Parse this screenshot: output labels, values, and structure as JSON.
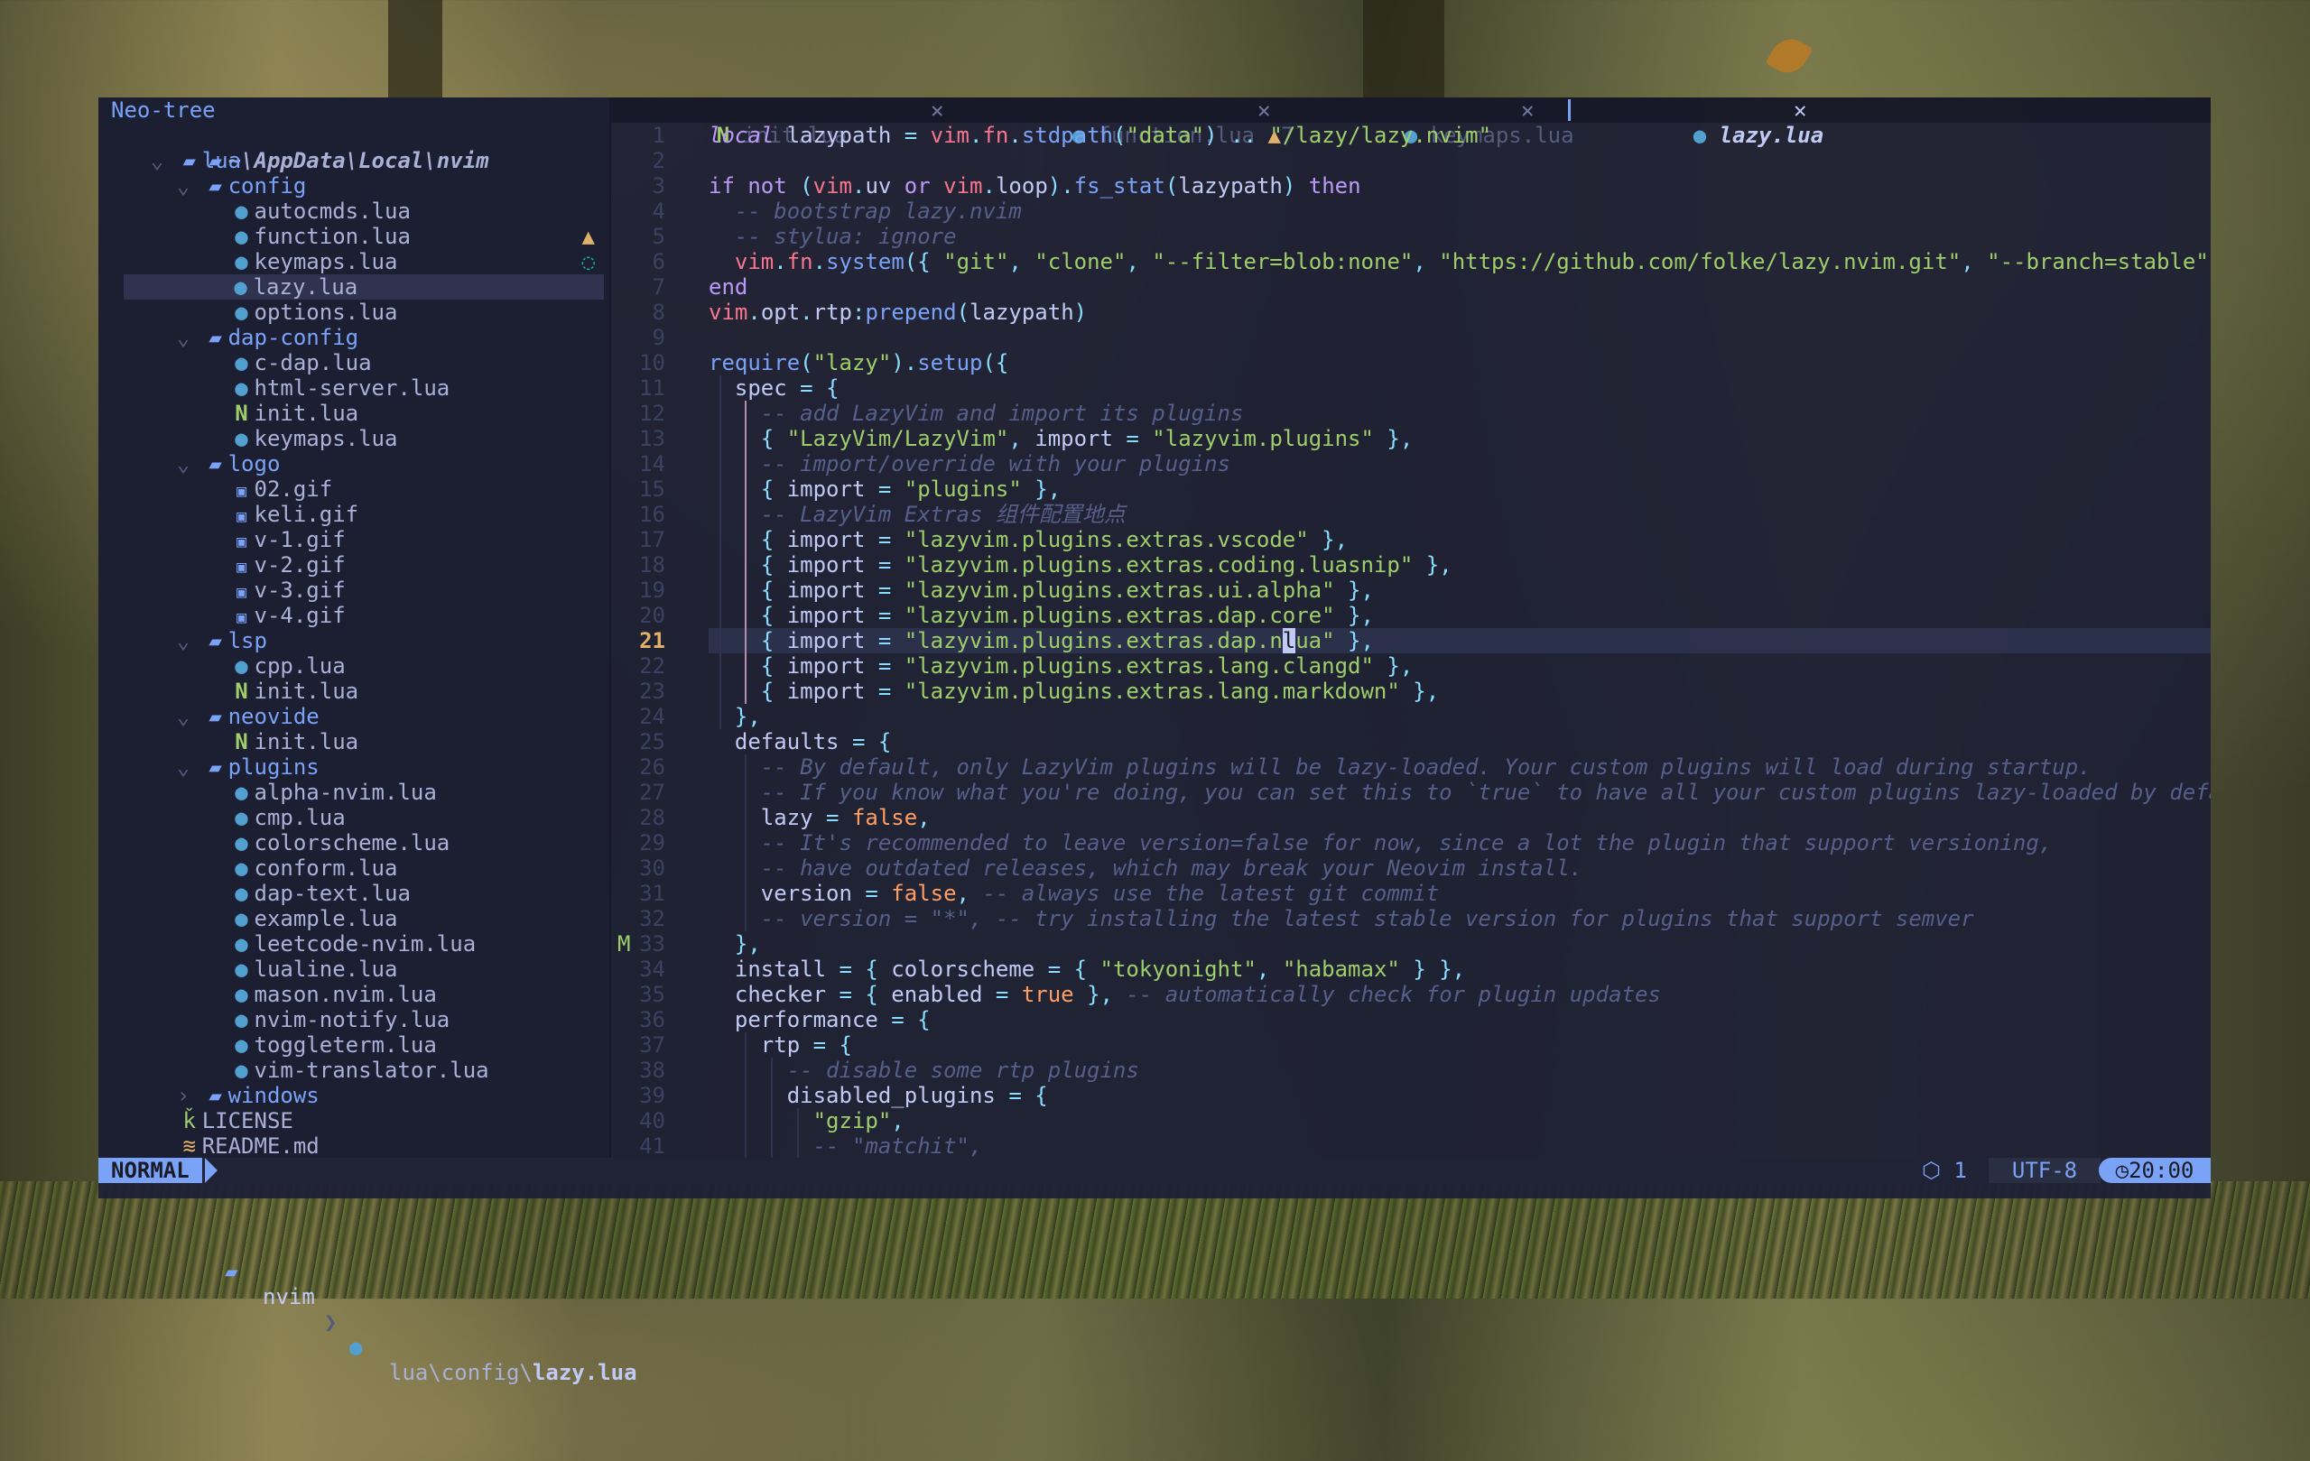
{
  "sidebar": {
    "title": "Neo-tree",
    "root": "~\\AppData\\Local\\nvim",
    "rows": [
      {
        "depth": 1,
        "type": "folder",
        "open": true,
        "name": "lua"
      },
      {
        "depth": 2,
        "type": "folder",
        "open": true,
        "name": "config"
      },
      {
        "depth": 3,
        "type": "lua",
        "name": "autocmds.lua"
      },
      {
        "depth": 3,
        "type": "lua",
        "name": "function.lua",
        "marker": "warn"
      },
      {
        "depth": 3,
        "type": "lua",
        "name": "keymaps.lua",
        "marker": "hint"
      },
      {
        "depth": 3,
        "type": "lua",
        "name": "lazy.lua",
        "selected": true
      },
      {
        "depth": 3,
        "type": "lua",
        "name": "options.lua"
      },
      {
        "depth": 2,
        "type": "folder",
        "open": true,
        "name": "dap-config"
      },
      {
        "depth": 3,
        "type": "lua",
        "name": "c-dap.lua"
      },
      {
        "depth": 3,
        "type": "lua",
        "name": "html-server.lua"
      },
      {
        "depth": 3,
        "type": "neovim",
        "name": "init.lua"
      },
      {
        "depth": 3,
        "type": "lua",
        "name": "keymaps.lua"
      },
      {
        "depth": 2,
        "type": "folder",
        "open": true,
        "name": "logo"
      },
      {
        "depth": 3,
        "type": "gif",
        "name": "02.gif"
      },
      {
        "depth": 3,
        "type": "gif",
        "name": "keli.gif"
      },
      {
        "depth": 3,
        "type": "gif",
        "name": "v-1.gif"
      },
      {
        "depth": 3,
        "type": "gif",
        "name": "v-2.gif"
      },
      {
        "depth": 3,
        "type": "gif",
        "name": "v-3.gif"
      },
      {
        "depth": 3,
        "type": "gif",
        "name": "v-4.gif"
      },
      {
        "depth": 2,
        "type": "folder",
        "open": true,
        "name": "lsp"
      },
      {
        "depth": 3,
        "type": "lua",
        "name": "cpp.lua"
      },
      {
        "depth": 3,
        "type": "neovim",
        "name": "init.lua"
      },
      {
        "depth": 2,
        "type": "folder",
        "open": true,
        "name": "neovide"
      },
      {
        "depth": 3,
        "type": "neovim",
        "name": "init.lua"
      },
      {
        "depth": 2,
        "type": "folder",
        "open": true,
        "name": "plugins"
      },
      {
        "depth": 3,
        "type": "lua",
        "name": "alpha-nvim.lua"
      },
      {
        "depth": 3,
        "type": "lua",
        "name": "cmp.lua"
      },
      {
        "depth": 3,
        "type": "lua",
        "name": "colorscheme.lua"
      },
      {
        "depth": 3,
        "type": "lua",
        "name": "conform.lua"
      },
      {
        "depth": 3,
        "type": "lua",
        "name": "dap-text.lua"
      },
      {
        "depth": 3,
        "type": "lua",
        "name": "example.lua"
      },
      {
        "depth": 3,
        "type": "lua",
        "name": "leetcode-nvim.lua",
        "marker": "modified",
        "marker_text": "M"
      },
      {
        "depth": 3,
        "type": "lua",
        "name": "lualine.lua"
      },
      {
        "depth": 3,
        "type": "lua",
        "name": "mason.nvim.lua"
      },
      {
        "depth": 3,
        "type": "lua",
        "name": "nvim-notify.lua"
      },
      {
        "depth": 3,
        "type": "lua",
        "name": "toggleterm.lua"
      },
      {
        "depth": 3,
        "type": "lua",
        "name": "vim-translator.lua"
      },
      {
        "depth": 2,
        "type": "folder",
        "open": false,
        "name": "windows"
      },
      {
        "depth": 1,
        "type": "license",
        "name": "LICENSE"
      },
      {
        "depth": 1,
        "type": "readme",
        "name": "README.md"
      }
    ]
  },
  "tabs": [
    {
      "icon": "neovim",
      "label": "init.lua",
      "active": false
    },
    {
      "icon": "lua",
      "label": "function.lua",
      "active": false,
      "diag": "7"
    },
    {
      "icon": "lua",
      "label": "keymaps.lua",
      "active": false
    },
    {
      "icon": "lua",
      "label": "lazy.lua",
      "active": true
    }
  ],
  "editor": {
    "current_line": 21,
    "lines": [
      [
        [
          "k",
          "local"
        ],
        [
          "v",
          " lazypath "
        ],
        [
          "p",
          "="
        ],
        [
          "v",
          " "
        ],
        [
          "id",
          "vim"
        ],
        [
          "p",
          "."
        ],
        [
          "id",
          "fn"
        ],
        [
          "p",
          "."
        ],
        [
          "f",
          "stdpath"
        ],
        [
          "p",
          "("
        ],
        [
          "s",
          "\"data\""
        ],
        [
          "p",
          ")"
        ],
        [
          "v",
          " "
        ],
        [
          "p",
          ".."
        ],
        [
          "v",
          " "
        ],
        [
          "s",
          "\"/lazy/lazy.nvim\""
        ]
      ],
      [],
      [
        [
          "kw",
          "if"
        ],
        [
          "v",
          " "
        ],
        [
          "kw",
          "not"
        ],
        [
          "v",
          " "
        ],
        [
          "p",
          "("
        ],
        [
          "id",
          "vim"
        ],
        [
          "p",
          "."
        ],
        [
          "v",
          "uv "
        ],
        [
          "kw",
          "or"
        ],
        [
          "v",
          " "
        ],
        [
          "id",
          "vim"
        ],
        [
          "p",
          "."
        ],
        [
          "v",
          "loop"
        ],
        [
          "p",
          ")."
        ],
        [
          "f",
          "fs_stat"
        ],
        [
          "p",
          "("
        ],
        [
          "v",
          "lazypath"
        ],
        [
          "p",
          ")"
        ],
        [
          "v",
          " "
        ],
        [
          "kw",
          "then"
        ]
      ],
      [
        [
          "v",
          "  "
        ],
        [
          "c",
          "-- bootstrap lazy.nvim"
        ]
      ],
      [
        [
          "v",
          "  "
        ],
        [
          "c",
          "-- stylua: ignore"
        ]
      ],
      [
        [
          "v",
          "  "
        ],
        [
          "id",
          "vim"
        ],
        [
          "p",
          "."
        ],
        [
          "id",
          "fn"
        ],
        [
          "p",
          "."
        ],
        [
          "f",
          "system"
        ],
        [
          "p",
          "({"
        ],
        [
          "v",
          " "
        ],
        [
          "s",
          "\"git\""
        ],
        [
          "p",
          ","
        ],
        [
          "v",
          " "
        ],
        [
          "s",
          "\"clone\""
        ],
        [
          "p",
          ","
        ],
        [
          "v",
          " "
        ],
        [
          "s",
          "\"--filter=blob:none\""
        ],
        [
          "p",
          ","
        ],
        [
          "v",
          " "
        ],
        [
          "s",
          "\"https://github.com/folke/lazy.nvim.git\""
        ],
        [
          "p",
          ","
        ],
        [
          "v",
          " "
        ],
        [
          "s",
          "\"--branch=stable\""
        ],
        [
          "p",
          ","
        ],
        [
          "v",
          " l"
        ]
      ],
      [
        [
          "kw",
          "end"
        ]
      ],
      [
        [
          "id",
          "vim"
        ],
        [
          "p",
          "."
        ],
        [
          "v",
          "opt"
        ],
        [
          "p",
          "."
        ],
        [
          "v",
          "rtp"
        ],
        [
          "p",
          ":"
        ],
        [
          "f",
          "prepend"
        ],
        [
          "p",
          "("
        ],
        [
          "v",
          "lazypath"
        ],
        [
          "p",
          ")"
        ]
      ],
      [],
      [
        [
          "f",
          "require"
        ],
        [
          "p",
          "("
        ],
        [
          "s",
          "\"lazy\""
        ],
        [
          "p",
          ")."
        ],
        [
          "f",
          "setup"
        ],
        [
          "p",
          "({"
        ]
      ],
      [
        [
          "v",
          "  spec "
        ],
        [
          "p",
          "="
        ],
        [
          "v",
          " "
        ],
        [
          "p",
          "{"
        ]
      ],
      [
        [
          "v",
          "    "
        ],
        [
          "c",
          "-- add LazyVim and import its plugins"
        ]
      ],
      [
        [
          "v",
          "    "
        ],
        [
          "p",
          "{"
        ],
        [
          "v",
          " "
        ],
        [
          "s",
          "\"LazyVim/LazyVim\""
        ],
        [
          "p",
          ","
        ],
        [
          "v",
          " import "
        ],
        [
          "p",
          "="
        ],
        [
          "v",
          " "
        ],
        [
          "s",
          "\"lazyvim.plugins\""
        ],
        [
          "v",
          " "
        ],
        [
          "p",
          "},"
        ]
      ],
      [
        [
          "v",
          "    "
        ],
        [
          "c",
          "-- import/override with your plugins"
        ]
      ],
      [
        [
          "v",
          "    "
        ],
        [
          "p",
          "{"
        ],
        [
          "v",
          " import "
        ],
        [
          "p",
          "="
        ],
        [
          "v",
          " "
        ],
        [
          "s",
          "\"plugins\""
        ],
        [
          "v",
          " "
        ],
        [
          "p",
          "},"
        ]
      ],
      [
        [
          "v",
          "    "
        ],
        [
          "c",
          "-- LazyVim Extras 组件配置地点"
        ]
      ],
      [
        [
          "v",
          "    "
        ],
        [
          "p",
          "{"
        ],
        [
          "v",
          " import "
        ],
        [
          "p",
          "="
        ],
        [
          "v",
          " "
        ],
        [
          "s",
          "\"lazyvim.plugins.extras.vscode\""
        ],
        [
          "v",
          " "
        ],
        [
          "p",
          "},"
        ]
      ],
      [
        [
          "v",
          "    "
        ],
        [
          "p",
          "{"
        ],
        [
          "v",
          " import "
        ],
        [
          "p",
          "="
        ],
        [
          "v",
          " "
        ],
        [
          "s",
          "\"lazyvim.plugins.extras.coding.luasnip\""
        ],
        [
          "v",
          " "
        ],
        [
          "p",
          "},"
        ]
      ],
      [
        [
          "v",
          "    "
        ],
        [
          "p",
          "{"
        ],
        [
          "v",
          " import "
        ],
        [
          "p",
          "="
        ],
        [
          "v",
          " "
        ],
        [
          "s",
          "\"lazyvim.plugins.extras.ui.alpha\""
        ],
        [
          "v",
          " "
        ],
        [
          "p",
          "},"
        ]
      ],
      [
        [
          "v",
          "    "
        ],
        [
          "p",
          "{"
        ],
        [
          "v",
          " import "
        ],
        [
          "p",
          "="
        ],
        [
          "v",
          " "
        ],
        [
          "s",
          "\"lazyvim.plugins.extras.dap.core\""
        ],
        [
          "v",
          " "
        ],
        [
          "p",
          "},"
        ]
      ],
      [
        [
          "v",
          "    "
        ],
        [
          "p",
          "{"
        ],
        [
          "v",
          " import "
        ],
        [
          "p",
          "="
        ],
        [
          "v",
          " "
        ],
        [
          "s",
          "\"lazyvim.plugins.extras.dap.n"
        ],
        [
          "cur",
          "l"
        ],
        [
          "s",
          "ua\""
        ],
        [
          "v",
          " "
        ],
        [
          "p",
          "},"
        ]
      ],
      [
        [
          "v",
          "    "
        ],
        [
          "p",
          "{"
        ],
        [
          "v",
          " import "
        ],
        [
          "p",
          "="
        ],
        [
          "v",
          " "
        ],
        [
          "s",
          "\"lazyvim.plugins.extras.lang.clangd\""
        ],
        [
          "v",
          " "
        ],
        [
          "p",
          "},"
        ]
      ],
      [
        [
          "v",
          "    "
        ],
        [
          "p",
          "{"
        ],
        [
          "v",
          " import "
        ],
        [
          "p",
          "="
        ],
        [
          "v",
          " "
        ],
        [
          "s",
          "\"lazyvim.plugins.extras.lang.markdown\""
        ],
        [
          "v",
          " "
        ],
        [
          "p",
          "},"
        ]
      ],
      [
        [
          "v",
          "  "
        ],
        [
          "p",
          "},"
        ]
      ],
      [
        [
          "v",
          "  defaults "
        ],
        [
          "p",
          "="
        ],
        [
          "v",
          " "
        ],
        [
          "p",
          "{"
        ]
      ],
      [
        [
          "v",
          "    "
        ],
        [
          "c",
          "-- By default, only LazyVim plugins will be lazy-loaded. Your custom plugins will load during startup."
        ]
      ],
      [
        [
          "v",
          "    "
        ],
        [
          "c",
          "-- If you know what you're doing, you can set this to `true` to have all your custom plugins lazy-loaded by defaul"
        ]
      ],
      [
        [
          "v",
          "    lazy "
        ],
        [
          "p",
          "="
        ],
        [
          "v",
          " "
        ],
        [
          "b",
          "false"
        ],
        [
          "p",
          ","
        ]
      ],
      [
        [
          "v",
          "    "
        ],
        [
          "c",
          "-- It's recommended to leave version=false for now, since a lot the plugin that support versioning,"
        ]
      ],
      [
        [
          "v",
          "    "
        ],
        [
          "c",
          "-- have outdated releases, which may break your Neovim install."
        ]
      ],
      [
        [
          "v",
          "    version "
        ],
        [
          "p",
          "="
        ],
        [
          "v",
          " "
        ],
        [
          "b",
          "false"
        ],
        [
          "p",
          ","
        ],
        [
          "v",
          " "
        ],
        [
          "c",
          "-- always use the latest git commit"
        ]
      ],
      [
        [
          "v",
          "    "
        ],
        [
          "c",
          "-- version = \"*\", -- try installing the latest stable version for plugins that support semver"
        ]
      ],
      [
        [
          "v",
          "  "
        ],
        [
          "p",
          "},"
        ]
      ],
      [
        [
          "v",
          "  install "
        ],
        [
          "p",
          "="
        ],
        [
          "v",
          " "
        ],
        [
          "p",
          "{"
        ],
        [
          "v",
          " colorscheme "
        ],
        [
          "p",
          "="
        ],
        [
          "v",
          " "
        ],
        [
          "p",
          "{"
        ],
        [
          "v",
          " "
        ],
        [
          "s",
          "\"tokyonight\""
        ],
        [
          "p",
          ","
        ],
        [
          "v",
          " "
        ],
        [
          "s",
          "\"habamax\""
        ],
        [
          "v",
          " "
        ],
        [
          "p",
          "}"
        ],
        [
          "v",
          " "
        ],
        [
          "p",
          "},"
        ]
      ],
      [
        [
          "v",
          "  checker "
        ],
        [
          "p",
          "="
        ],
        [
          "v",
          " "
        ],
        [
          "p",
          "{"
        ],
        [
          "v",
          " enabled "
        ],
        [
          "p",
          "="
        ],
        [
          "v",
          " "
        ],
        [
          "b",
          "true"
        ],
        [
          "v",
          " "
        ],
        [
          "p",
          "},"
        ],
        [
          "v",
          " "
        ],
        [
          "c",
          "-- automatically check for plugin updates"
        ]
      ],
      [
        [
          "v",
          "  performance "
        ],
        [
          "p",
          "="
        ],
        [
          "v",
          " "
        ],
        [
          "p",
          "{"
        ]
      ],
      [
        [
          "v",
          "    rtp "
        ],
        [
          "p",
          "="
        ],
        [
          "v",
          " "
        ],
        [
          "p",
          "{"
        ]
      ],
      [
        [
          "v",
          "      "
        ],
        [
          "c",
          "-- disable some rtp plugins"
        ]
      ],
      [
        [
          "v",
          "      disabled_plugins "
        ],
        [
          "p",
          "="
        ],
        [
          "v",
          " "
        ],
        [
          "p",
          "{"
        ]
      ],
      [
        [
          "v",
          "        "
        ],
        [
          "s",
          "\"gzip\""
        ],
        [
          "p",
          ","
        ]
      ],
      [
        [
          "v",
          "        "
        ],
        [
          "c",
          "-- \"matchit\","
        ]
      ]
    ]
  },
  "statusline": {
    "mode": "NORMAL",
    "project": "nvim",
    "path_prefix": "lua\\config\\",
    "filename": "lazy.lua",
    "lsp_count": "1",
    "encoding": "UTF-8",
    "time": "20:00"
  },
  "colors": {
    "accent": "#7aa2f7",
    "string": "#9ece6a",
    "keyword": "#bb9af7",
    "comment": "#565f89",
    "warning": "#e0af68"
  }
}
